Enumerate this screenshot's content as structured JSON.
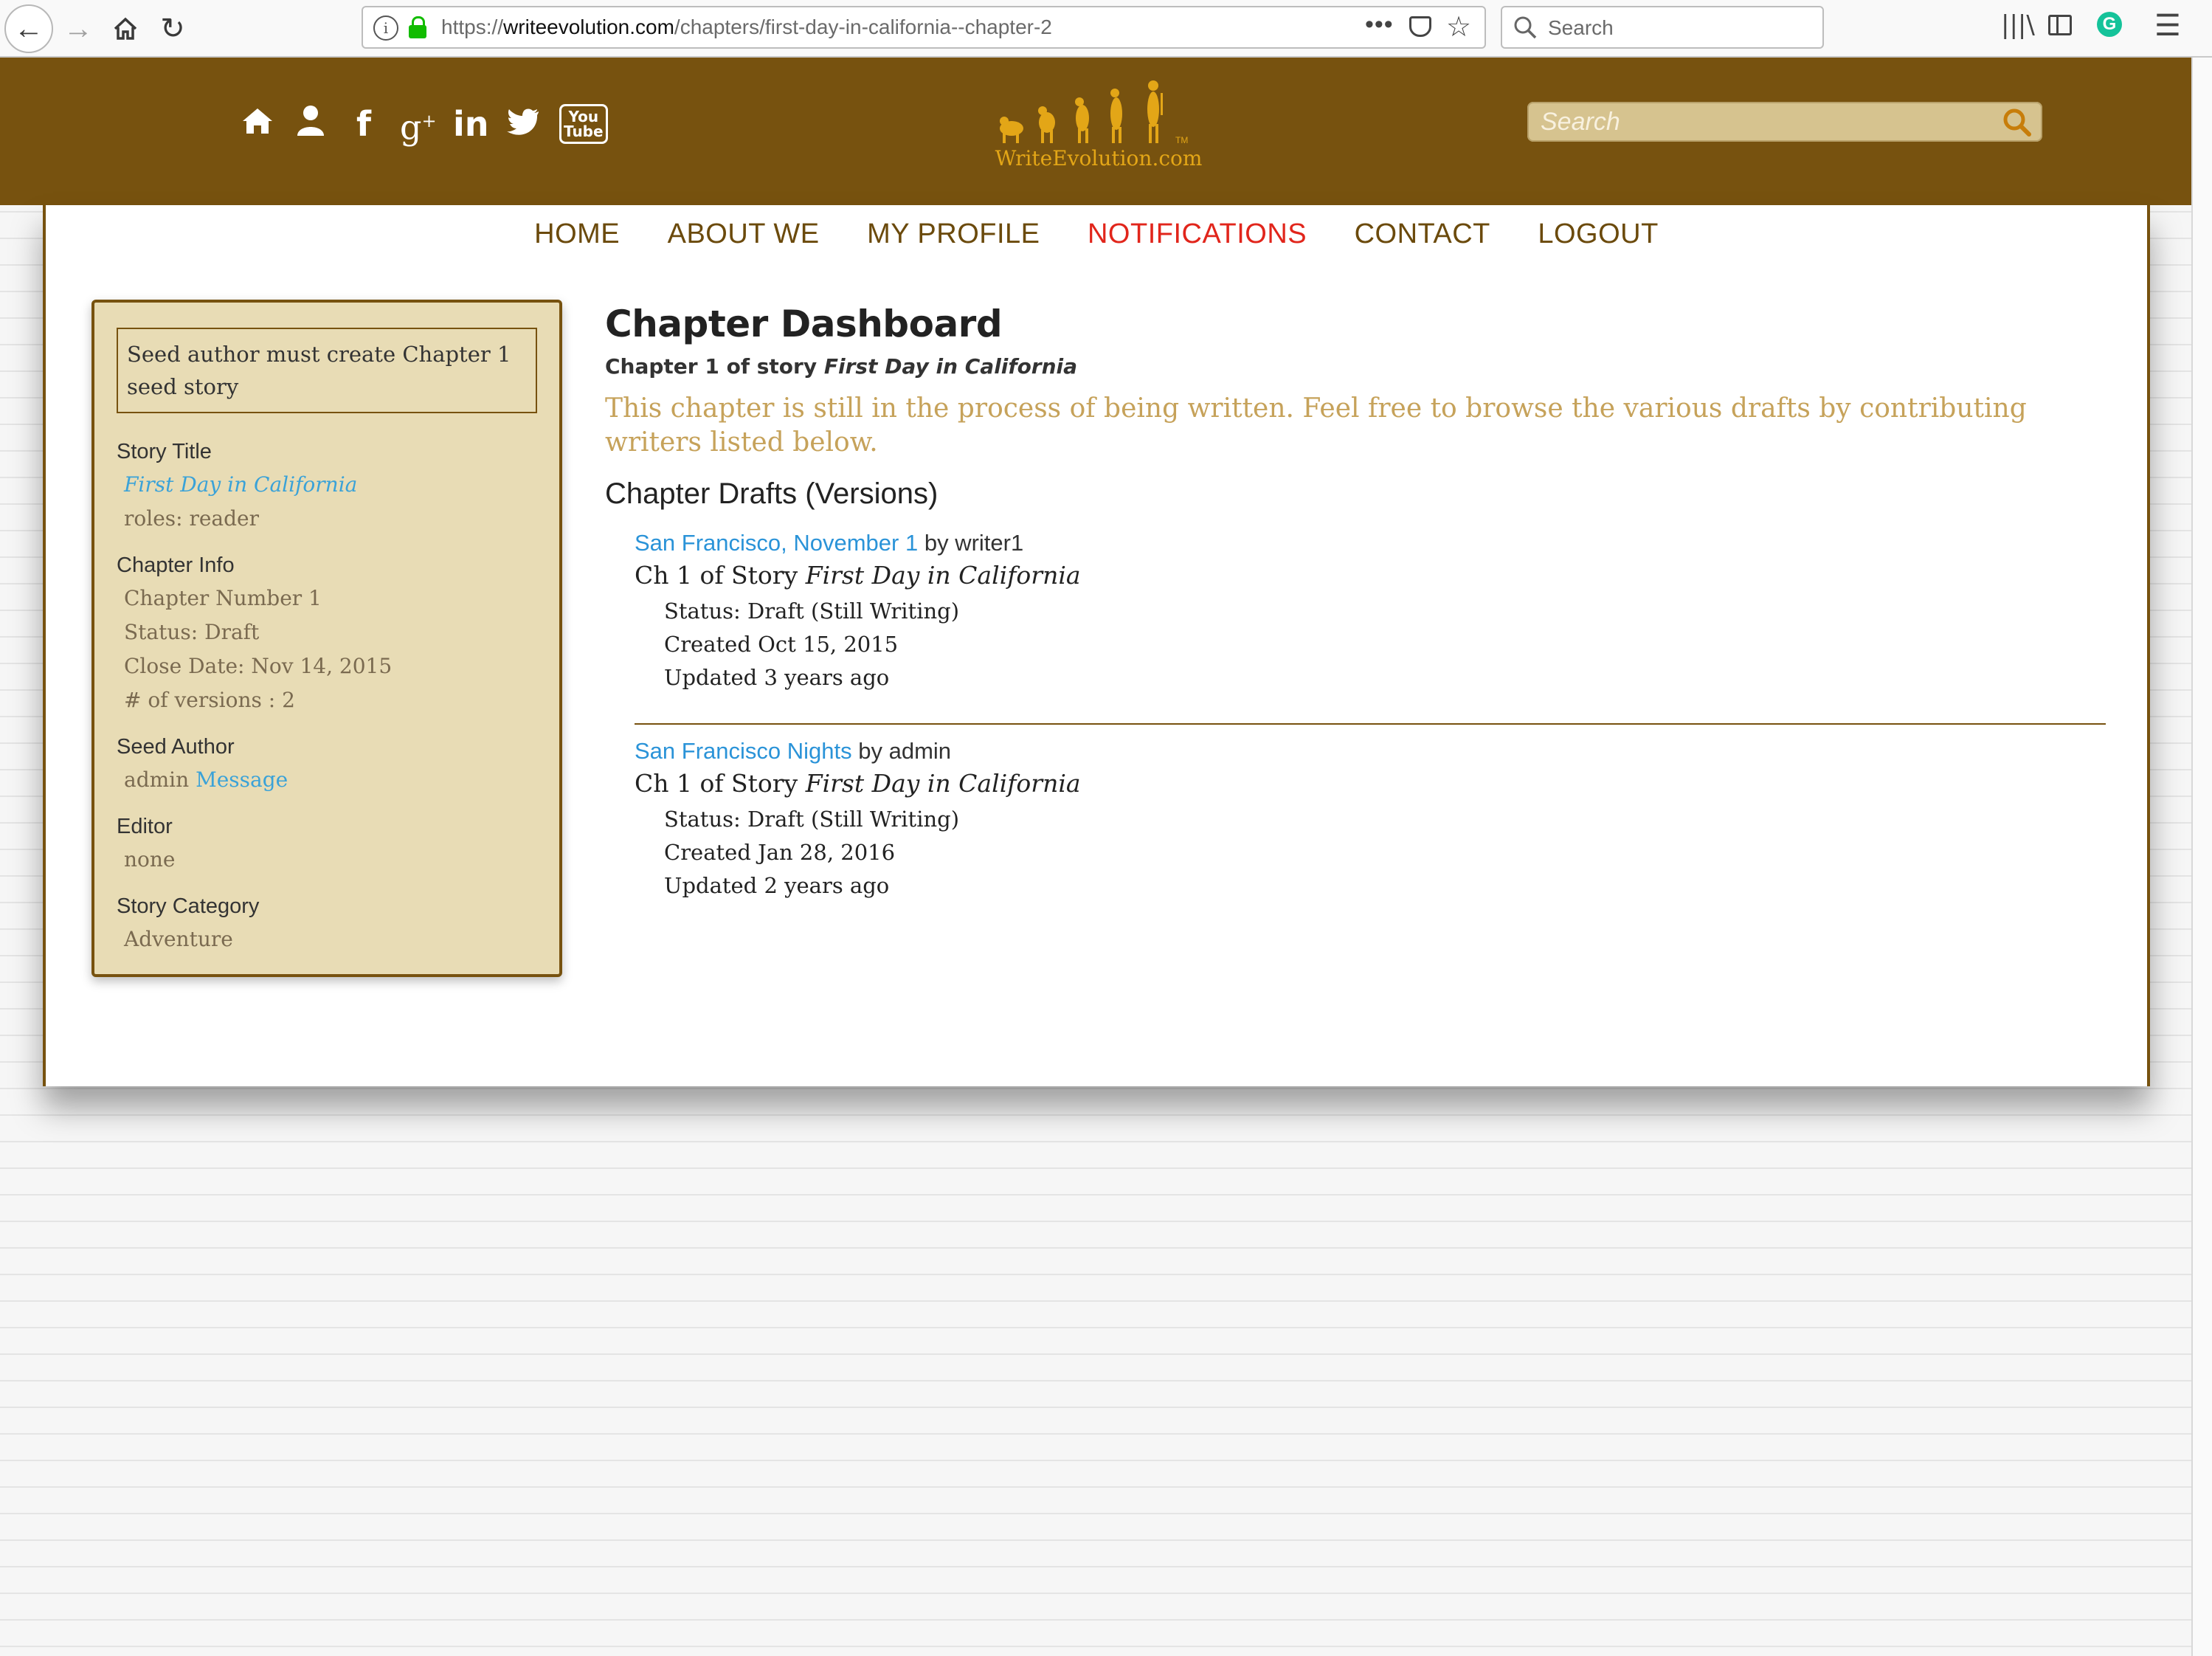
{
  "browser": {
    "url_scheme": "https://",
    "url_domain": "writeevolution.com",
    "url_path": "/chapters/first-day-in-california--chapter-2",
    "search_placeholder": "Search"
  },
  "header": {
    "logo_text": "WriteEvolution.com",
    "search_placeholder": "Search",
    "social_icons": [
      "home-icon",
      "user-icon",
      "facebook-icon",
      "google-plus-icon",
      "linkedin-icon",
      "twitter-icon",
      "youtube-icon"
    ],
    "brand_color": "#77520f",
    "logo_color": "#e3a617"
  },
  "nav": {
    "items": [
      {
        "label": "HOME"
      },
      {
        "label": "ABOUT WE"
      },
      {
        "label": "MY PROFILE"
      },
      {
        "label": "NOTIFICATIONS"
      },
      {
        "label": "CONTACT"
      },
      {
        "label": "LOGOUT"
      }
    ],
    "active_color": "#e1251b"
  },
  "sidebar": {
    "seed_note": "Seed author must create Chapter 1 seed story",
    "story_title_head": "Story Title",
    "story_title": "First Day in California",
    "roles": "roles: reader",
    "chapter_info_head": "Chapter Info",
    "chapter_number": "Chapter Number 1",
    "status": "Status: Draft",
    "close_date": "Close Date: Nov 14, 2015",
    "versions": "# of versions : 2",
    "seed_author_head": "Seed Author",
    "seed_author": "admin",
    "message_link": "Message",
    "editor_head": "Editor",
    "editor": "none",
    "category_head": "Story Category",
    "category": "Adventure"
  },
  "main": {
    "title": "Chapter Dashboard",
    "subtitle_prefix": "Chapter 1 of story",
    "subtitle_story": "First Day in California",
    "notice": "This chapter is still in the process of being written. Feel free to browse the various drafts by contributing writers listed below.",
    "drafts_heading": "Chapter Drafts (Versions)",
    "drafts": [
      {
        "title": "San Francisco, November 1",
        "author": "by writer1",
        "story_prefix": "Ch 1 of Story",
        "story": "First Day in California",
        "status": "Status: Draft (Still Writing)",
        "created": "Created Oct 15, 2015",
        "updated": "Updated 3 years ago"
      },
      {
        "title": "San Francisco Nights",
        "author": "by admin",
        "story_prefix": "Ch 1 of Story",
        "story": "First Day in California",
        "status": "Status: Draft (Still Writing)",
        "created": "Created Jan 28, 2016",
        "updated": "Updated 2 years ago"
      }
    ]
  }
}
